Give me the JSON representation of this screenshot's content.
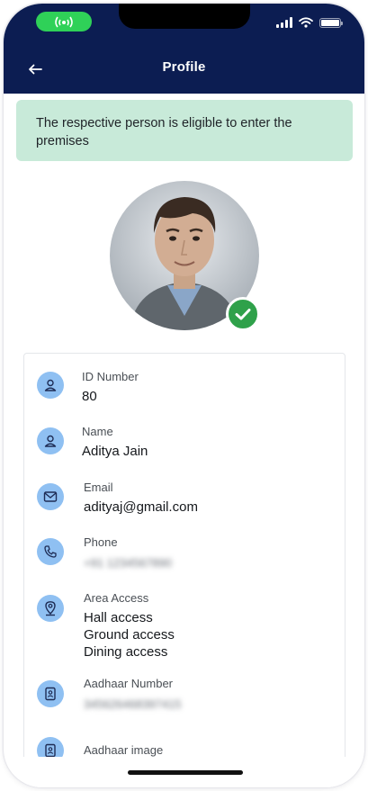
{
  "header": {
    "title": "Profile",
    "background": "#0c1d52",
    "status_pill_color": "#2fd158"
  },
  "banner": {
    "message": "The respective person is eligible to enter the premises",
    "color": "#c8ead9"
  },
  "profile": {
    "verified": true,
    "fields": [
      {
        "label": "ID Number",
        "value": "80",
        "icon": "user-icon"
      },
      {
        "label": "Name",
        "value": "Aditya Jain",
        "icon": "user-icon"
      },
      {
        "label": "Email",
        "value": "adityaj@gmail.com",
        "icon": "mail-icon"
      },
      {
        "label": "Phone",
        "value": "+91 1234567890",
        "icon": "phone-icon",
        "blurred": true
      },
      {
        "label": "Area Access",
        "values": [
          "Hall access",
          "Ground access",
          "Dining access"
        ],
        "icon": "map-pin-icon"
      },
      {
        "label": "Aadhaar Number",
        "value": "345626468397415",
        "icon": "id-card-icon",
        "blurred": true
      },
      {
        "label": "Aadhaar image",
        "icon": "id-card-icon"
      }
    ]
  }
}
